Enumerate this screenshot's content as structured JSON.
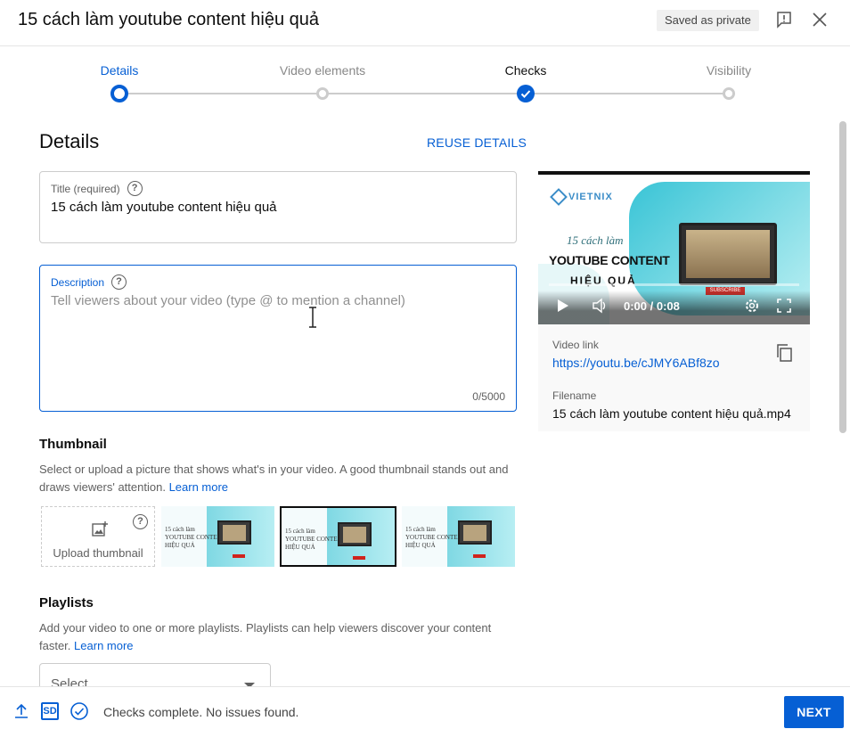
{
  "header": {
    "title": "15 cách làm youtube content hiệu quả",
    "saved_badge": "Saved as private"
  },
  "stepper": {
    "steps": [
      {
        "label": "Details",
        "state": "active"
      },
      {
        "label": "Video elements",
        "state": "pending"
      },
      {
        "label": "Checks",
        "state": "done"
      },
      {
        "label": "Visibility",
        "state": "pending"
      }
    ]
  },
  "details": {
    "heading": "Details",
    "reuse_label": "REUSE DETAILS",
    "title_field": {
      "label": "Title (required)",
      "value": "15 cách làm youtube content hiệu quả"
    },
    "description_field": {
      "label": "Description",
      "placeholder": "Tell viewers about your video (type @ to mention a channel)",
      "counter": "0/5000"
    },
    "thumbnail": {
      "heading": "Thumbnail",
      "desc": "Select or upload a picture that shows what's in your video. A good thumbnail stands out and draws viewers' attention.",
      "learn_more": "Learn more",
      "upload_label": "Upload thumbnail",
      "options": [
        {
          "line1": "15 cách làm",
          "line2": "YOUTUBE CONTENT",
          "line3": "HIỆU QUẢ",
          "selected": false
        },
        {
          "line1": "15 cách làm",
          "line2": "YOUTUBE CONTENT",
          "line3": "HIỆU QUẢ",
          "selected": true
        },
        {
          "line1": "15 cách làm",
          "line2": "YOUTUBE CONTENT",
          "line3": "HIỆU QUẢ",
          "selected": false
        }
      ]
    },
    "playlists": {
      "heading": "Playlists",
      "desc": "Add your video to one or more playlists. Playlists can help viewers discover your content faster.",
      "learn_more": "Learn more",
      "select_value": "Select"
    }
  },
  "video": {
    "logo": "VIETNIX",
    "title_line1": "15 cách làm",
    "title_line2": "YOUTUBE CONTENT",
    "title_line3": "HIỆU QUẢ",
    "subscribe": "SUBSCRIBE",
    "time": "0:00 / 0:08",
    "link_label": "Video link",
    "link": "https://youtu.be/cJMY6ABf8zo",
    "filename_label": "Filename",
    "filename": "15 cách làm youtube content hiệu quả.mp4"
  },
  "footer": {
    "status": "Checks complete. No issues found.",
    "sd_badge": "SD",
    "next_label": "NEXT"
  },
  "colors": {
    "accent": "#065fd4",
    "border": "#cccccc",
    "muted_text": "#606060"
  }
}
